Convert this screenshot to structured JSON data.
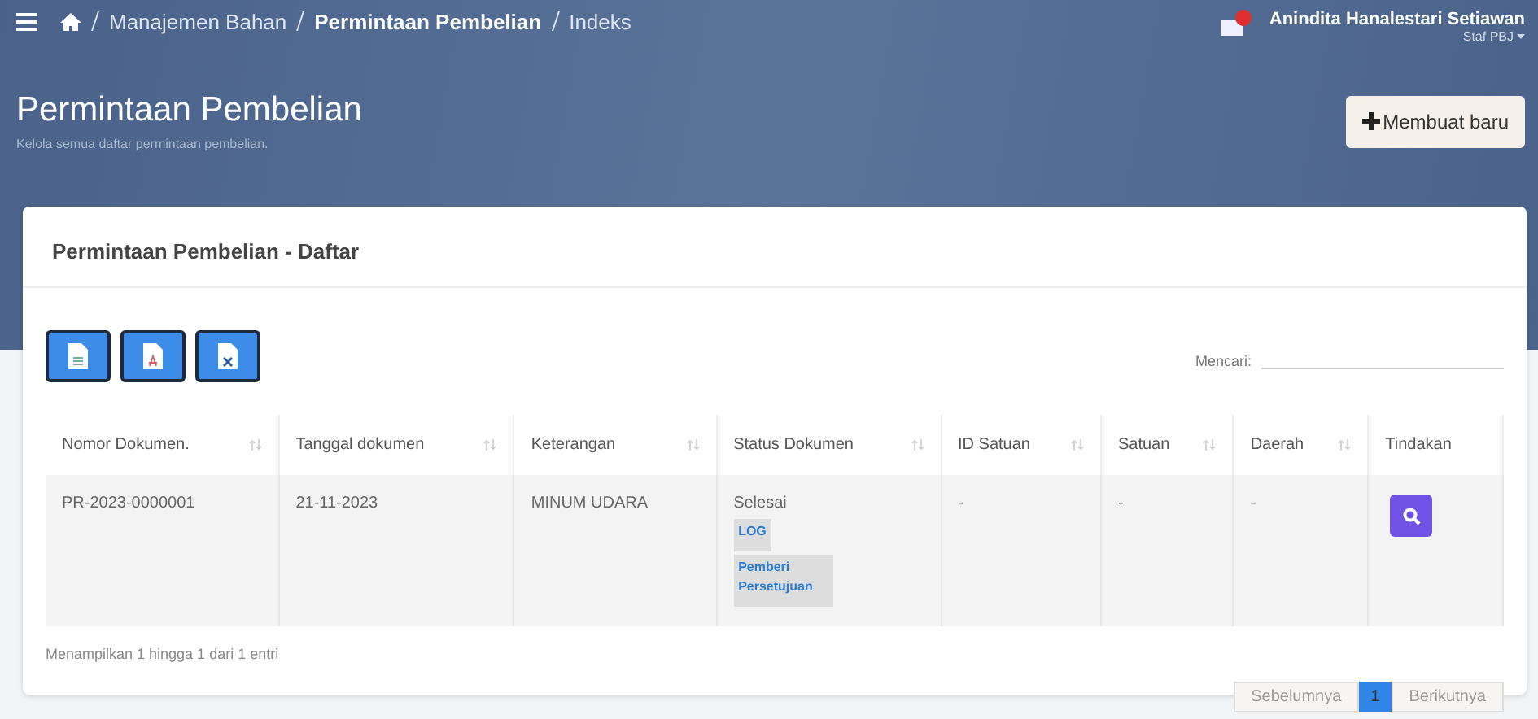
{
  "breadcrumb": [
    {
      "label": "Manajemen Bahan",
      "current": false
    },
    {
      "label": "Permintaan Pembelian",
      "current": true
    },
    {
      "label": "Indeks",
      "current": false
    }
  ],
  "user": {
    "name": "Anindita Hanalestari Setiawan",
    "role": "Staf PBJ"
  },
  "page": {
    "title": "Permintaan Pembelian",
    "subtitle": "Kelola semua daftar permintaan pembelian.",
    "create_button": "Membuat baru"
  },
  "card": {
    "title": "Permintaan Pembelian - Daftar",
    "search": {
      "label": "Mencari:"
    }
  },
  "export_buttons": [
    {
      "kind": "doc"
    },
    {
      "kind": "pdf"
    },
    {
      "kind": "excel"
    }
  ],
  "table": {
    "columns": [
      {
        "label": "Nomor Dokumen.",
        "sortable": true
      },
      {
        "label": "Tanggal dokumen",
        "sortable": true
      },
      {
        "label": "Keterangan",
        "sortable": true
      },
      {
        "label": "Status Dokumen",
        "sortable": true
      },
      {
        "label": "ID Satuan",
        "sortable": true
      },
      {
        "label": "Satuan",
        "sortable": true
      },
      {
        "label": "Daerah",
        "sortable": true
      },
      {
        "label": "Tindakan",
        "sortable": false
      }
    ],
    "rows": [
      {
        "nomor": "PR-2023-0000001",
        "tanggal": "21-11-2023",
        "keterangan": "MINUM UDARA",
        "status": "Selesai",
        "badges": [
          "LOG",
          "Pemberi Persetujuan"
        ],
        "id_satuan": "-",
        "satuan": "-",
        "daerah": "-"
      }
    ]
  },
  "info": "Menampilkan 1 hingga 1 dari 1 entri",
  "pagination": [
    {
      "label": "Sebelumnya",
      "selected": false,
      "disabled": true
    },
    {
      "label": "1",
      "selected": true,
      "disabled": false
    },
    {
      "label": "Berikutnya",
      "selected": false,
      "disabled": true
    }
  ]
}
